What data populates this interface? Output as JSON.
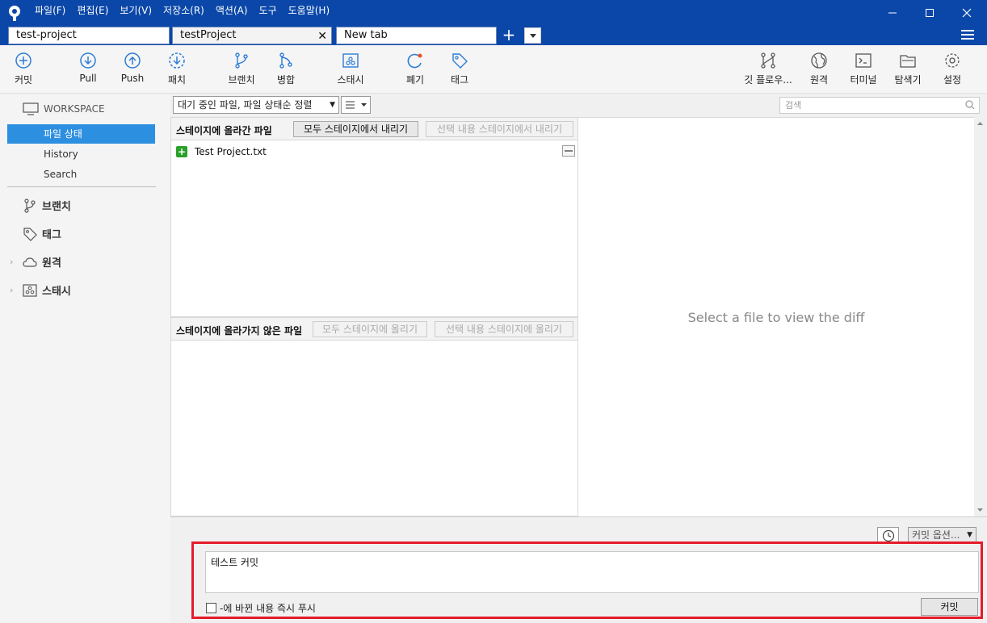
{
  "menubar": [
    "파일(F)",
    "편집(E)",
    "보기(V)",
    "저장소(R)",
    "액션(A)",
    "도구",
    "도움말(H)"
  ],
  "tabs": [
    {
      "label": "test-project"
    },
    {
      "label": "testProject"
    },
    {
      "label": "New tab"
    }
  ],
  "toolbar": {
    "commit": "커밋",
    "pull": "Pull",
    "push": "Push",
    "fetch": "패치",
    "branch": "브랜치",
    "merge": "병합",
    "stash": "스태시",
    "discard": "폐기",
    "tag": "태그",
    "gitflow": "깃 플로우...",
    "remote": "원격",
    "terminal": "터미널",
    "explorer": "탐색기",
    "settings": "설정"
  },
  "sidebar": {
    "workspace": "WORKSPACE",
    "file_status": "파일 상태",
    "history": "History",
    "search": "Search",
    "branches": "브랜치",
    "tags": "태그",
    "remotes": "원격",
    "stashes": "스태시"
  },
  "filter": {
    "select": "대기 중인 파일, 파일 상태순 정렬",
    "search_placeholder": "검색"
  },
  "staged": {
    "title": "스테이지에 올라간 파일",
    "unstage_all": "모두 스테이지에서 내리기",
    "unstage_selected": "선택 내용 스테이지에서 내리기",
    "files": [
      {
        "name": "Test Project.txt",
        "status": "added"
      }
    ]
  },
  "unstaged": {
    "title": "스테이지에 올라가지 않은 파일",
    "stage_all": "모두 스테이지에 올리기",
    "stage_selected": "선택 내용 스테이지에 올리기"
  },
  "diff": {
    "placeholder": "Select a file to view the diff"
  },
  "commit": {
    "options": "커밋 옵션...",
    "message": "테스트 커밋",
    "push_immediately": "-에 바뀐 내용 즉시 푸시",
    "button": "커밋",
    "highlight_color": "#e51b2a"
  },
  "colors": {
    "titlebar": "#0a47a8",
    "selection": "#2d8fe0"
  }
}
